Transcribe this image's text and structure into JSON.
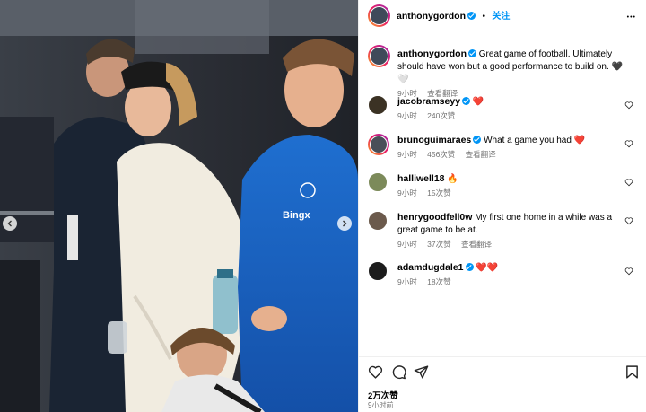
{
  "post": {
    "author": "anthonygordon",
    "follow_label": "关注",
    "dot": "•",
    "more_label": "•••",
    "caption": "Great game of football. Ultimately should have won but a good performance to build on. 🖤🤍",
    "caption_time": "9小时",
    "translate_label": "查看翻译",
    "likes": "2万次赞",
    "time": "9小时前"
  },
  "comments": [
    {
      "user": "jacobramseyy",
      "text": "❤️",
      "time": "9小时",
      "likes": "240次赞",
      "reply": "",
      "avatar_color": "#3b3224"
    },
    {
      "user": "brunoguimaraes",
      "text": "What a game you had ❤️",
      "time": "9小时",
      "likes": "456次赞",
      "reply": "查看翻译",
      "avatar_color": "#4a4f58"
    },
    {
      "user": "halliwell18",
      "text": "🔥",
      "time": "9小时",
      "likes": "15次赞",
      "reply": "",
      "avatar_color": "#7c8a5a"
    },
    {
      "user": "henrygoodfell0w",
      "text": "My first one home in a while was a great game to be at.",
      "time": "9小时",
      "likes": "37次赞",
      "reply": "查看翻译",
      "avatar_color": "#6b5a4c"
    },
    {
      "user": "adamdugdale1",
      "text": "❤️❤️",
      "time": "9小时",
      "likes": "18次赞",
      "reply": "",
      "avatar_color": "#1c1c1c"
    }
  ],
  "colors": {
    "accent": "#0095f6",
    "secondary_text": "#737373",
    "border": "#efefef",
    "heart": "#e0245e"
  },
  "icons": {
    "like": "heart-icon",
    "comment": "comment-icon",
    "share": "send-icon",
    "save": "bookmark-icon"
  }
}
